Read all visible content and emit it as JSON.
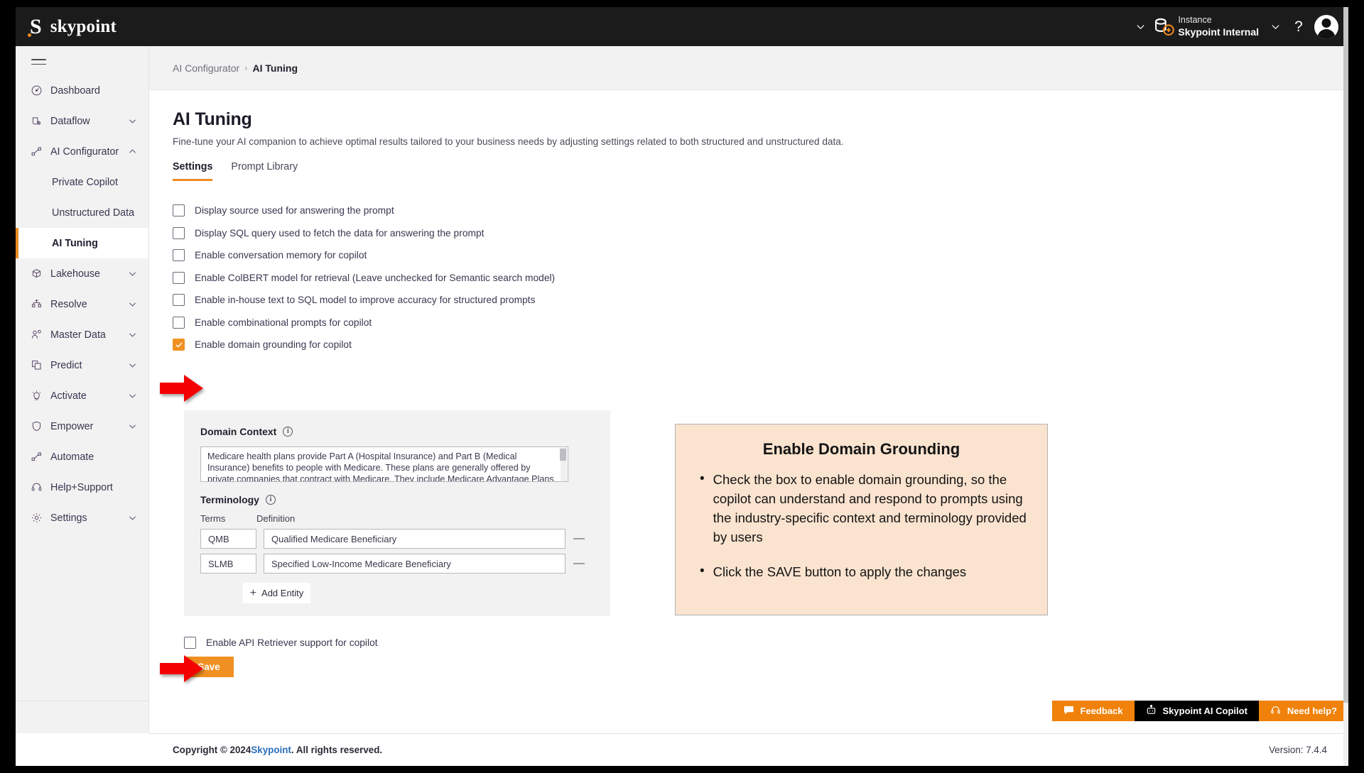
{
  "topbar": {
    "brand_mark": "S",
    "brand_name": "skypoint",
    "instance_label": "Instance",
    "instance_value": "Skypoint Internal",
    "help_glyph": "?"
  },
  "sidebar": {
    "items": [
      {
        "label": "Dashboard",
        "icon": "gauge-icon",
        "expandable": false
      },
      {
        "label": "Dataflow",
        "icon": "dataflow-icon",
        "expandable": true
      },
      {
        "label": "AI Configurator",
        "icon": "ai-configurator-icon",
        "expandable": true,
        "expanded": true
      }
    ],
    "sub_items": [
      {
        "label": "Private Copilot",
        "active": false
      },
      {
        "label": "Unstructured Data",
        "active": false
      },
      {
        "label": "AI Tuning",
        "active": true
      }
    ],
    "items_after": [
      {
        "label": "Lakehouse",
        "icon": "cube-icon",
        "expandable": true
      },
      {
        "label": "Resolve",
        "icon": "resolve-icon",
        "expandable": true
      },
      {
        "label": "Master Data",
        "icon": "person-node-icon",
        "expandable": true
      },
      {
        "label": "Predict",
        "icon": "predict-icon",
        "expandable": true
      },
      {
        "label": "Activate",
        "icon": "lightbulb-icon",
        "expandable": true
      },
      {
        "label": "Empower",
        "icon": "shield-icon",
        "expandable": true
      },
      {
        "label": "Automate",
        "icon": "automate-icon",
        "expandable": false
      },
      {
        "label": "Help+Support",
        "icon": "headset-icon",
        "expandable": false
      },
      {
        "label": "Settings",
        "icon": "gear-icon",
        "expandable": true
      }
    ]
  },
  "breadcrumb": {
    "parent": "AI Configurator",
    "separator": "›",
    "current": "AI Tuning"
  },
  "page": {
    "title": "AI Tuning",
    "subtitle": "Fine-tune your AI companion to achieve optimal results tailored to your business needs by adjusting settings related to both structured and unstructured data.",
    "tabs": [
      {
        "label": "Settings",
        "active": true
      },
      {
        "label": "Prompt Library",
        "active": false
      }
    ]
  },
  "settings": {
    "checkboxes": [
      {
        "label": "Display source used for answering the prompt",
        "checked": false
      },
      {
        "label": "Display SQL query used to fetch the data for answering the prompt",
        "checked": false
      },
      {
        "label": "Enable conversation memory for copilot",
        "checked": false
      },
      {
        "label": "Enable ColBERT model for retrieval (Leave unchecked for Semantic search model)",
        "checked": false
      },
      {
        "label": "Enable in-house text to SQL model to improve accuracy for structured prompts",
        "checked": false
      },
      {
        "label": "Enable combinational prompts for copilot",
        "checked": false
      },
      {
        "label": "Enable domain grounding for copilot",
        "checked": true
      }
    ],
    "api_retriever": {
      "label": "Enable API Retriever support for copilot",
      "checked": false
    },
    "save_label": "Save"
  },
  "domain_panel": {
    "context_heading": "Domain Context",
    "context_info_glyph": "i",
    "context_value": "Medicare health plans provide Part A (Hospital Insurance) and Part B (Medical Insurance) benefits to people with Medicare. These plans are generally offered by private companies that contract with Medicare. They include Medicare Advantage Plans (Part C), Medicare Cost Plans,",
    "terminology_heading": "Terminology",
    "terminology_info_glyph": "i",
    "col_terms": "Terms",
    "col_definition": "Definition",
    "rows": [
      {
        "term": "QMB",
        "definition": "Qualified Medicare Beneficiary",
        "remove": "—"
      },
      {
        "term": "SLMB",
        "definition": "Specified Low-Income Medicare Beneficiary",
        "remove": "—"
      }
    ],
    "add_entity_label": "Add Entity",
    "add_entity_plus": "+"
  },
  "callout": {
    "title": "Enable Domain Grounding",
    "bullets": [
      "Check the box to enable domain grounding, so the copilot can understand and respond to prompts using the industry-specific context and terminology provided by users",
      "Click the SAVE button to apply the changes"
    ],
    "bullet_glyph": "•",
    "bg_color": "#fae3cf"
  },
  "widgets": [
    {
      "label": "Feedback",
      "icon": "chat-icon",
      "style": "orange"
    },
    {
      "label": "Skypoint AI Copilot",
      "icon": "robot-icon",
      "style": "black"
    },
    {
      "label": "Need help?",
      "icon": "headset-icon",
      "style": "orange"
    }
  ],
  "footer": {
    "copyright_prefix": "Copyright © 2024 ",
    "copyright_link": "Skypoint",
    "copyright_suffix": ". All rights reserved.",
    "version": "Version: 7.4.4"
  },
  "accent_colors": {
    "orange": "#ef8b22",
    "arrow_red": "#f40000",
    "topbar_dark": "#1b1b1b"
  }
}
